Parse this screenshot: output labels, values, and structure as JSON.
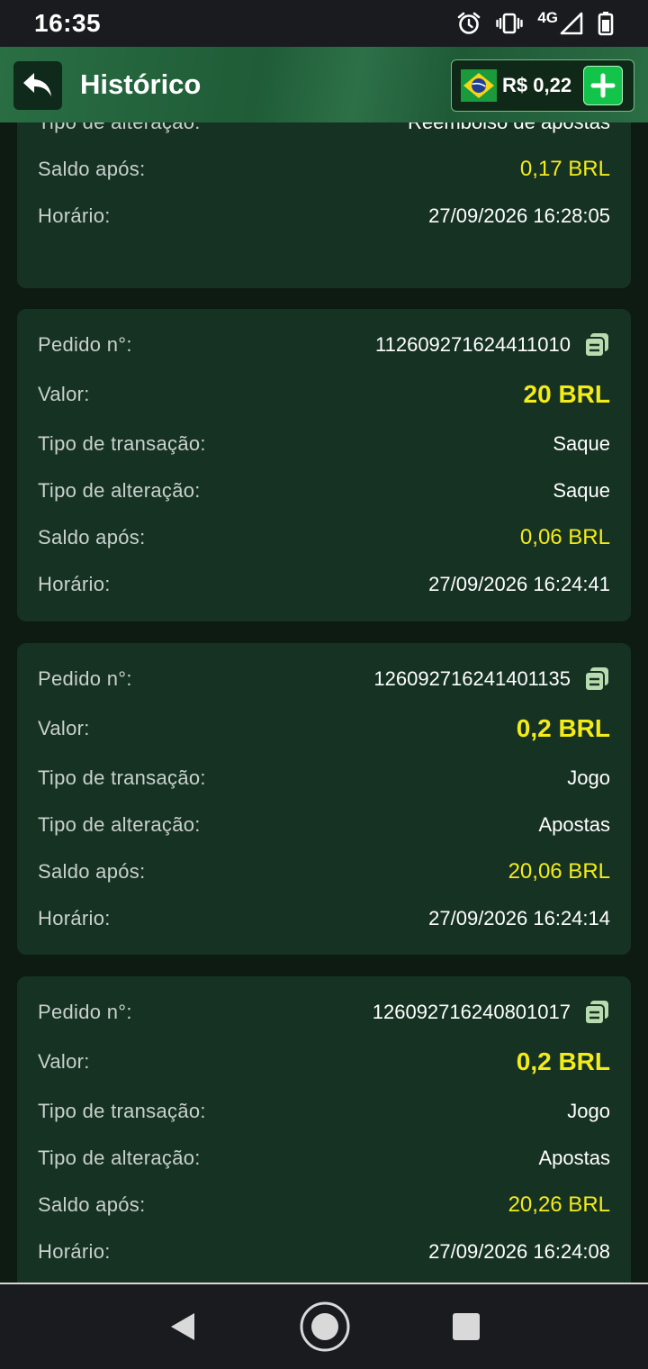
{
  "status_bar": {
    "time": "16:35",
    "network": "4G",
    "icons": [
      "alarm-icon",
      "vibrate-icon",
      "signal-icon",
      "battery-icon"
    ]
  },
  "header": {
    "title": "Histórico",
    "balance": "R$ 0,22",
    "flag": "brazil-flag-icon"
  },
  "colors": {
    "accent_yellow": "#f3ec19",
    "card_bg": "#163223",
    "add_green": "#12c44a"
  },
  "labels": {
    "order": "Pedido n°:",
    "value": "Valor:",
    "transaction_type": "Tipo de transação:",
    "change_type": "Tipo de alteração:",
    "balance_after": "Saldo após:",
    "time": "Horário:"
  },
  "partial_card": {
    "change_type": "Reembolso de apostas",
    "balance_after": "0,17 BRL",
    "time": "27/09/2026 16:28:05"
  },
  "records": [
    {
      "order": "112609271624411010",
      "value": "20 BRL",
      "transaction_type": "Saque",
      "change_type": "Saque",
      "balance_after": "0,06 BRL",
      "time": "27/09/2026 16:24:41"
    },
    {
      "order": "126092716241401135",
      "value": "0,2 BRL",
      "transaction_type": "Jogo",
      "change_type": "Apostas",
      "balance_after": "20,06 BRL",
      "time": "27/09/2026 16:24:14"
    },
    {
      "order": "126092716240801017",
      "value": "0,2 BRL",
      "transaction_type": "Jogo",
      "change_type": "Apostas",
      "balance_after": "20,26 BRL",
      "time": "27/09/2026 16:24:08"
    }
  ]
}
